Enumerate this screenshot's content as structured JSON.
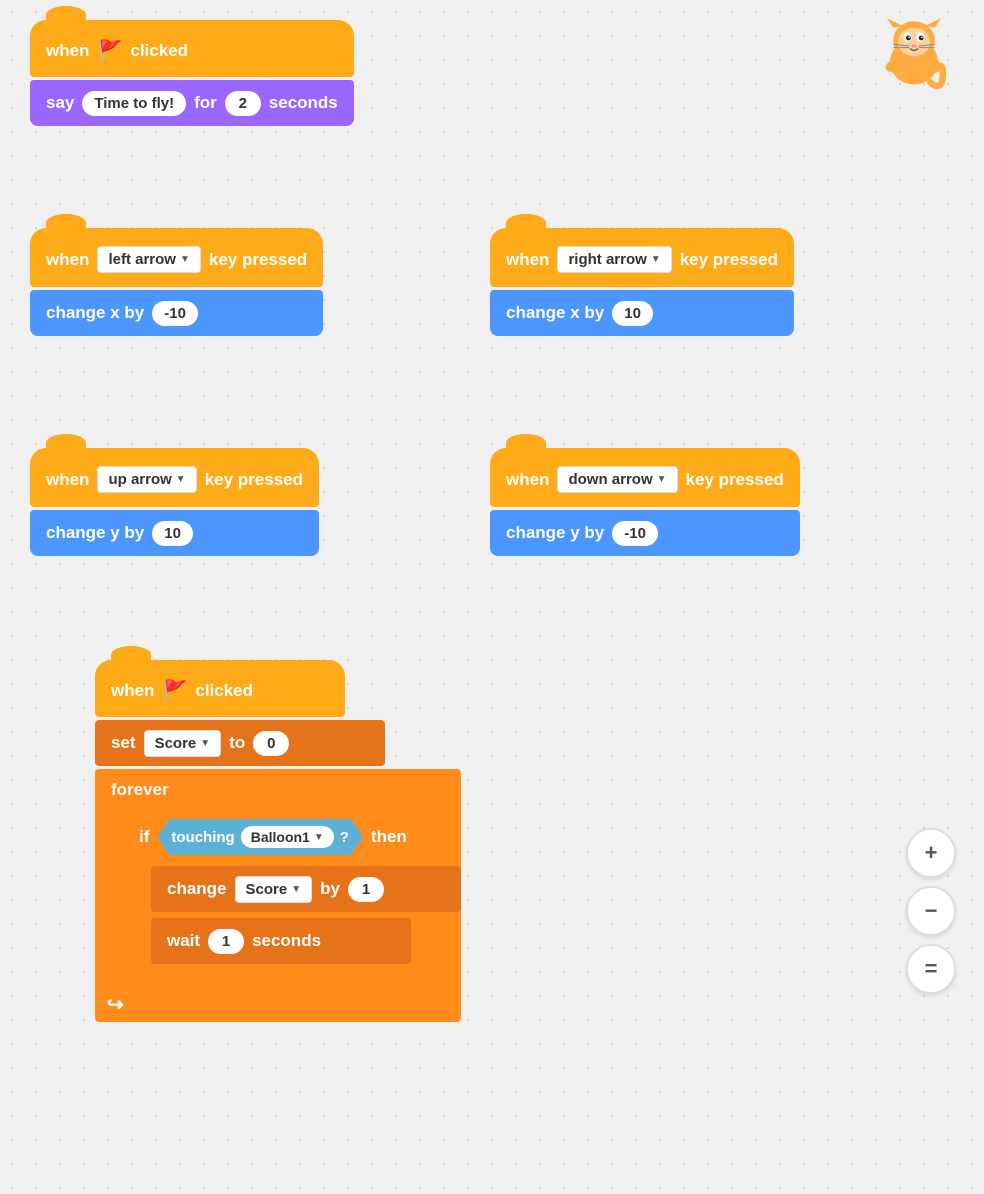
{
  "blocks": {
    "group1": {
      "hat": "when 🚩 clicked",
      "hat_label_when": "when",
      "hat_label_clicked": "clicked",
      "action": "say",
      "action_value": "Time to fly!",
      "action_for": "for",
      "action_seconds_val": "2",
      "action_seconds": "seconds"
    },
    "group2_left": {
      "hat_when": "when",
      "hat_key": "left arrow",
      "hat_pressed": "key pressed",
      "action": "change x by",
      "action_val": "-10"
    },
    "group2_right": {
      "hat_when": "when",
      "hat_key": "right arrow",
      "hat_pressed": "key pressed",
      "action": "change x by",
      "action_val": "10"
    },
    "group3_left": {
      "hat_when": "when",
      "hat_key": "up arrow",
      "hat_pressed": "key pressed",
      "action": "change y by",
      "action_val": "10"
    },
    "group3_right": {
      "hat_when": "when",
      "hat_key": "down arrow",
      "hat_pressed": "key pressed",
      "action": "change y by",
      "action_val": "-10"
    },
    "group4": {
      "hat_when": "when",
      "hat_clicked": "clicked",
      "set_label": "set",
      "set_var": "Score",
      "set_to": "to",
      "set_val": "0",
      "forever_label": "forever",
      "if_label": "if",
      "touching_label": "touching",
      "touching_val": "Balloon1",
      "then_label": "then",
      "change_label": "change",
      "change_var": "Score",
      "change_by": "by",
      "change_val": "1",
      "wait_label": "wait",
      "wait_val": "1",
      "wait_seconds": "seconds"
    }
  },
  "zoom": {
    "plus": "+",
    "minus": "−",
    "equals": "="
  }
}
